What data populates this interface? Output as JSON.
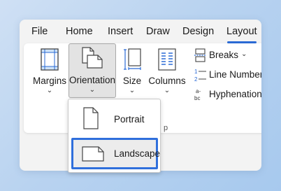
{
  "tabs": [
    {
      "label": "File"
    },
    {
      "label": "Home"
    },
    {
      "label": "Insert"
    },
    {
      "label": "Draw"
    },
    {
      "label": "Design"
    },
    {
      "label": "Layout"
    }
  ],
  "active_tab": "Layout",
  "ribbon": {
    "margins": {
      "label": "Margins",
      "icon": "margins-icon"
    },
    "orientation": {
      "label": "Orientation",
      "icon": "orientation-icon"
    },
    "size": {
      "label": "Size",
      "icon": "size-icon"
    },
    "columns": {
      "label": "Columns",
      "icon": "columns-icon"
    },
    "breaks": {
      "label": "Breaks",
      "icon": "breaks-icon"
    },
    "line_numbers": {
      "label": "Line Numbers",
      "icon": "line-numbers-icon"
    },
    "hyphenation": {
      "label": "Hyphenation",
      "icon": "hyphenation-icon"
    },
    "group_label_fragment": "p"
  },
  "orientation_menu": {
    "items": [
      {
        "label": "Portrait",
        "icon": "portrait-page-icon",
        "selected": false
      },
      {
        "label": "Landscape",
        "icon": "landscape-page-icon",
        "selected": true
      }
    ]
  },
  "colors": {
    "accent": "#2b6bd6",
    "selection_border": "#2f6fdc",
    "background_gradient_start": "#cfe0f4",
    "background_gradient_end": "#a7c9ee"
  }
}
